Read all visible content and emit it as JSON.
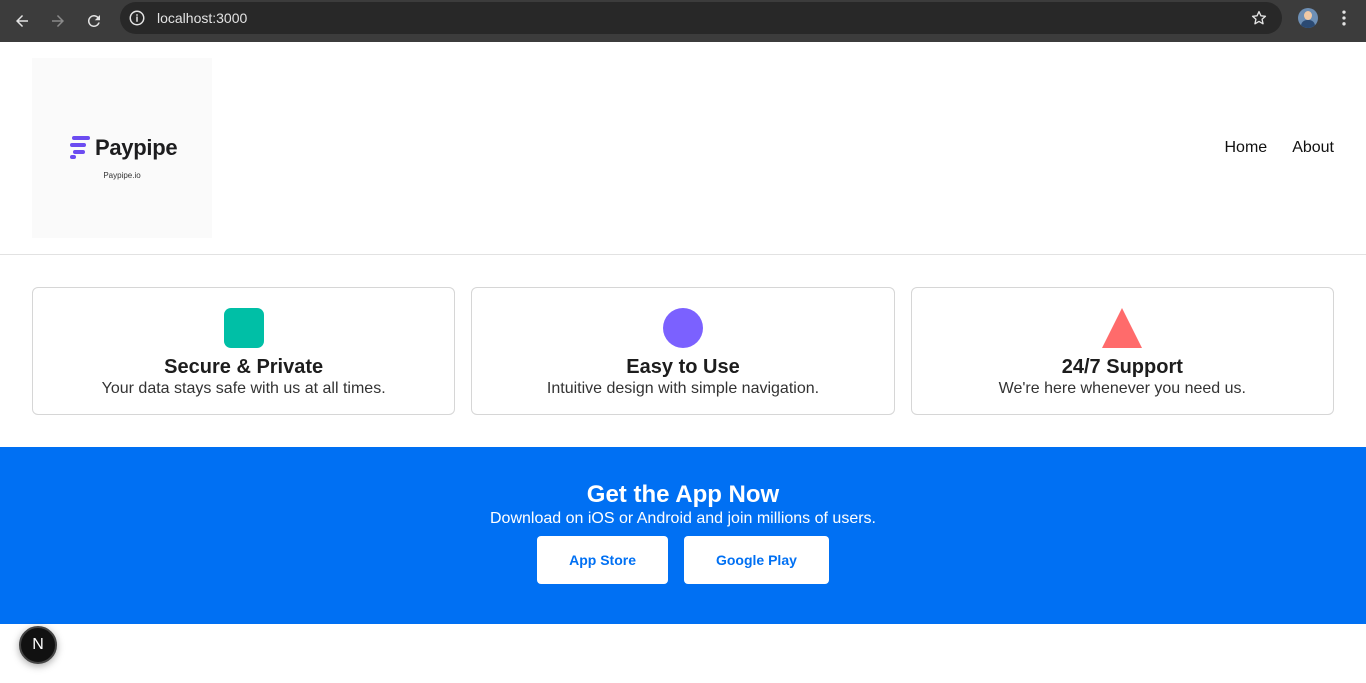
{
  "browser": {
    "url": "localhost:3000",
    "icons": [
      "back-arrow-icon",
      "forward-arrow-icon",
      "reload-icon",
      "info-icon",
      "star-icon",
      "kebab-menu-icon"
    ]
  },
  "header": {
    "logo_name": "Paypipe",
    "logo_domain": "Paypipe.io",
    "nav": [
      {
        "label": "Home"
      },
      {
        "label": "About"
      }
    ]
  },
  "features": [
    {
      "title": "Secure & Private",
      "description": "Your data stays safe with us at all times.",
      "shape": "square",
      "color": "#00bfa6"
    },
    {
      "title": "Easy to Use",
      "description": "Intuitive design with simple navigation.",
      "shape": "circle",
      "color": "#7b61ff"
    },
    {
      "title": "24/7 Support",
      "description": "We're here whenever you need us.",
      "shape": "triangle",
      "color": "#ff6b6b"
    }
  ],
  "cta": {
    "title": "Get the App Now",
    "subtitle": "Download on iOS or Android and join millions of users.",
    "buttons": [
      {
        "label": "App Store"
      },
      {
        "label": "Google Play"
      }
    ],
    "background_color": "#0070f3"
  },
  "dev_indicator": {
    "label": "N"
  }
}
